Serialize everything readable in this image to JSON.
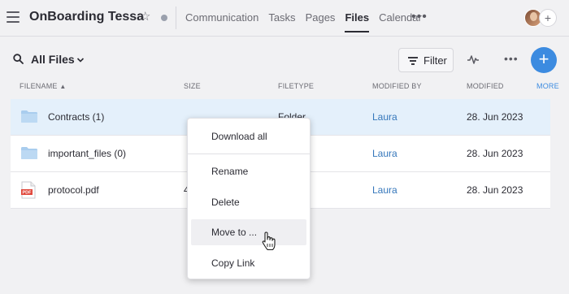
{
  "header": {
    "project_title": "OnBoarding Tessa",
    "tabs": [
      {
        "label": "Communication",
        "active": false
      },
      {
        "label": "Tasks",
        "active": false
      },
      {
        "label": "Pages",
        "active": false
      },
      {
        "label": "Files",
        "active": true
      },
      {
        "label": "Calendar",
        "active": false
      }
    ],
    "more_glyph": "•••",
    "add_glyph": "+",
    "icons": [
      "menu-icon",
      "star-icon",
      "status-dot",
      "more-icon",
      "avatar",
      "add-member-icon"
    ]
  },
  "toolbar": {
    "view_label": "All Files",
    "filter_label": "Filter",
    "more_glyph": "•••",
    "add_glyph": "+",
    "accent_color": "#3c8be0"
  },
  "table": {
    "columns": [
      "FILENAME",
      "SIZE",
      "FILETYPE",
      "MODIFIED BY",
      "MODIFIED",
      "MORE"
    ],
    "rows": [
      {
        "name": "Contracts (1)",
        "size": "",
        "type": "Folder",
        "modified_by": "Laura",
        "modified": "28. Jun 2023",
        "icon": "folder-icon",
        "selected": true
      },
      {
        "name": "important_files (0)",
        "size": "",
        "type": "",
        "modified_by": "Laura",
        "modified": "28. Jun 2023",
        "icon": "folder-icon",
        "selected": false
      },
      {
        "name": "protocol.pdf",
        "size": "4",
        "type": "",
        "modified_by": "Laura",
        "modified": "28. Jun 2023",
        "icon": "pdf-icon",
        "selected": false
      }
    ]
  },
  "context_menu": {
    "items": [
      "Download all",
      "Rename",
      "Delete",
      "Move to ...",
      "Copy Link"
    ],
    "hovered": "Move to ..."
  },
  "pdf_badge": "PDF"
}
